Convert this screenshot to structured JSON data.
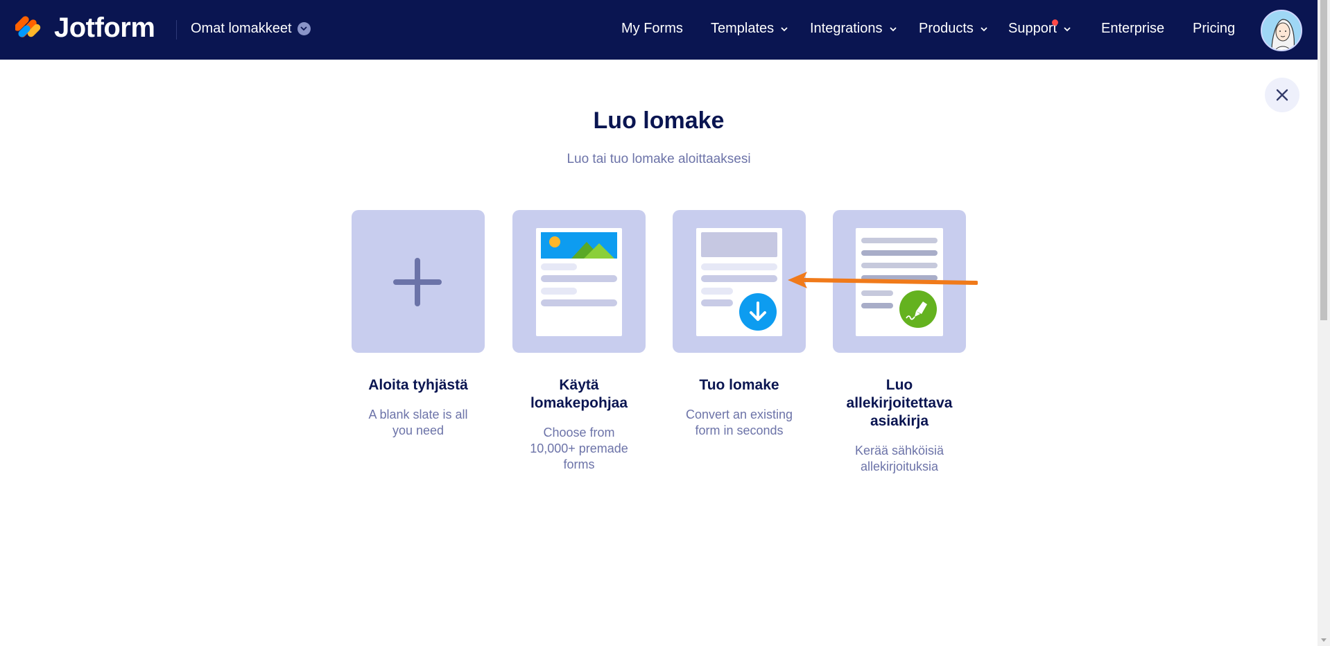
{
  "header": {
    "logo_text": "Jotform",
    "workspace_label": "Omat lomakkeet",
    "nav": {
      "my_forms": "My Forms",
      "templates": "Templates",
      "integrations": "Integrations",
      "products": "Products",
      "support": "Support",
      "enterprise": "Enterprise",
      "pricing": "Pricing"
    }
  },
  "page": {
    "title": "Luo lomake",
    "subtitle": "Luo tai tuo lomake aloittaaksesi"
  },
  "cards": [
    {
      "title": "Aloita tyhjästä",
      "description": "A blank slate is all you need"
    },
    {
      "title": "Käytä lomakepohjaa",
      "description": "Choose from 10,000+ premade forms"
    },
    {
      "title": "Tuo lomake",
      "description": "Convert an existing form in seconds"
    },
    {
      "title": "Luo allekirjoitettava asiakirja",
      "description": "Kerää sähköisiä allekirjoituksia"
    }
  ],
  "colors": {
    "header_bg": "#0a1551",
    "tile_bg": "#c8cdee",
    "title_text": "#0a1551",
    "muted_text": "#6c73a8",
    "annotation_arrow": "#f07a1a",
    "download_badge": "#0d9cf0",
    "signature_badge": "#64b21f"
  },
  "icons": [
    "jotform-logo-icon",
    "chevron-down-icon",
    "avatar",
    "close-icon",
    "plus-icon",
    "image-icon",
    "download-icon",
    "signature-pen-icon",
    "annotation-arrow"
  ]
}
